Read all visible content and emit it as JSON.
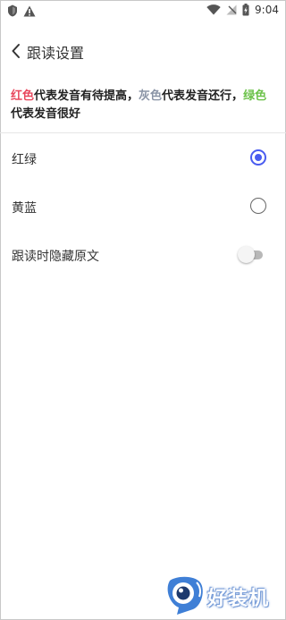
{
  "status_bar": {
    "time": "9:04"
  },
  "header": {
    "title": "跟读设置"
  },
  "description": {
    "red_word": "红色",
    "red_text": "代表发音有待提高，",
    "gray_word": "灰色",
    "gray_text": "代表发音还行，",
    "green_word": "绿色",
    "green_text": "代表发音很好"
  },
  "options": [
    {
      "label": "红绿",
      "selected": true
    },
    {
      "label": "黄蓝",
      "selected": false
    }
  ],
  "hide_text_toggle": {
    "label": "跟读时隐藏原文",
    "enabled": false
  },
  "watermark": {
    "text": "好装机"
  },
  "colors": {
    "accent": "#4a5cf0",
    "red": "#e8485e",
    "gray": "#8a94a6",
    "green": "#6cc24a"
  }
}
